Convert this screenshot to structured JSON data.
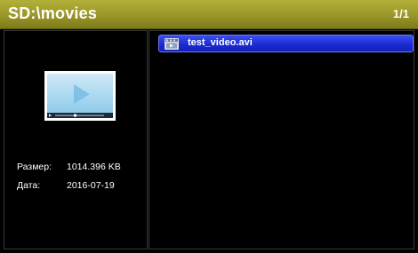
{
  "header": {
    "path": "SD:\\movies",
    "page_indicator": "1/1"
  },
  "details": {
    "size_label": "Размер:",
    "size_value": "1014.396 KB",
    "date_label": "Дата:",
    "date_value": "2016-07-19"
  },
  "file_list": {
    "items": [
      {
        "name": "test_video.avi",
        "icon": "video-file-icon",
        "selected": true
      }
    ]
  },
  "colors": {
    "header_bg": "#9a9628",
    "selection_bg": "#1a2ad0",
    "pane_border": "#3a3a3a"
  }
}
